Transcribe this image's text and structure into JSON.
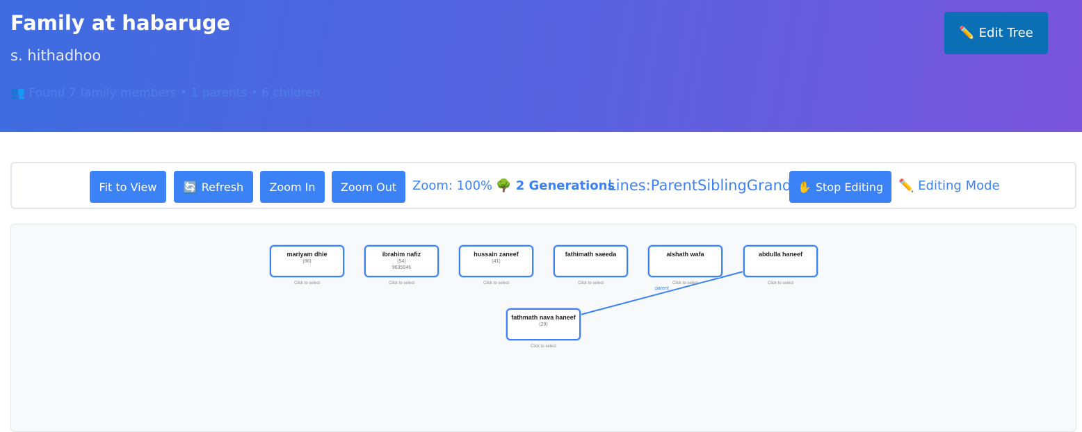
{
  "header": {
    "title": "Family at habaruge",
    "subtitle": "s. hithadhoo",
    "stats": "👥 Found 7 family members • 1 parents • 6 children",
    "edit_tree": {
      "icon": "pencil-icon",
      "glyph": "✏️",
      "label": "Edit Tree"
    }
  },
  "toolbar": {
    "fit_to_view": "Fit to View",
    "refresh": {
      "icon": "refresh-icon",
      "glyph": "🔄",
      "label": "Refresh"
    },
    "zoom_in": "Zoom In",
    "zoom_out": "Zoom Out",
    "zoom_status": "Zoom: 100%",
    "generations": {
      "icon": "tree-icon",
      "glyph": "🌳",
      "label": "2 Generations"
    },
    "lines_status": "Lines:ParentSiblingGrand",
    "stop_editing": {
      "icon": "hand-icon",
      "glyph": "✋",
      "label": "Stop Editing"
    },
    "editing_mode": {
      "icon": "pencil-icon",
      "glyph": "✏️",
      "label": "Editing Mode"
    }
  },
  "tree": {
    "select_hint": "Click to select",
    "connection_label": "parent",
    "members": [
      {
        "name": "mariyam dhie",
        "age": "(86)",
        "phone": ""
      },
      {
        "name": "ibrahim nafiz",
        "age": "(54)",
        "phone": "9635946"
      },
      {
        "name": "hussain zaneef",
        "age": "(41)",
        "phone": ""
      },
      {
        "name": "fathimath saeeda",
        "age": "",
        "phone": ""
      },
      {
        "name": "aishath wafa",
        "age": "",
        "phone": ""
      },
      {
        "name": "abdulla haneef",
        "age": "",
        "phone": ""
      },
      {
        "name": "fathmath nava haneef",
        "age": "(29)",
        "phone": ""
      }
    ]
  },
  "colors": {
    "accent": "#3b82f6",
    "edit_tree_button": "#0b6fb5",
    "header_gradient_start": "#3e6ce0",
    "header_gradient_end": "#7a55dc"
  }
}
